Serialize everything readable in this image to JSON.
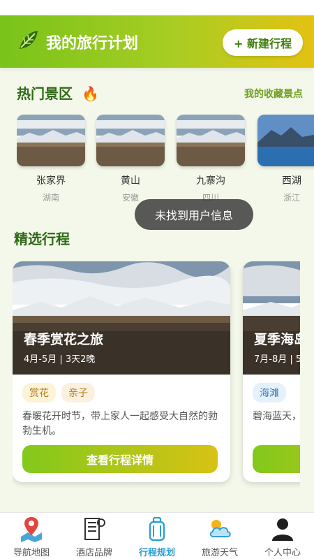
{
  "header": {
    "title": "我的旅行计划",
    "new_button": "+ 新建行程"
  },
  "hot": {
    "title": "热门景区",
    "fav_link": "我的收藏景点",
    "spots": [
      {
        "name": "张家界",
        "province": "湖南"
      },
      {
        "name": "黄山",
        "province": "安徽"
      },
      {
        "name": "九寨沟",
        "province": "四川"
      },
      {
        "name": "西湖",
        "province": "浙江"
      }
    ]
  },
  "toast": "未找到用户信息",
  "featured": {
    "title": "精选行程",
    "trips": [
      {
        "name": "春季赏花之旅",
        "meta": "4月-5月 | 3天2晚",
        "tags": [
          "赏花",
          "亲子"
        ],
        "desc": "春暖花开时节，带上家人一起感受大自然的勃勃生机。",
        "cta": "查看行程详情"
      },
      {
        "name": "夏季海岛",
        "meta": "7月-8月 | 5",
        "tags": [
          "海滩",
          ""
        ],
        "desc": "碧海蓝天，意时光。",
        "cta": ""
      }
    ]
  },
  "tabs": [
    {
      "label": "导航地图",
      "icon": "map-pin-icon"
    },
    {
      "label": "酒店品牌",
      "icon": "hotel-icon"
    },
    {
      "label": "行程规划",
      "icon": "luggage-icon"
    },
    {
      "label": "旅游天气",
      "icon": "weather-icon"
    },
    {
      "label": "个人中心",
      "icon": "user-icon"
    }
  ],
  "colors": {
    "accent": "#79c31a",
    "active_tab": "#2d9fd6",
    "title_green": "#2f6a16"
  }
}
